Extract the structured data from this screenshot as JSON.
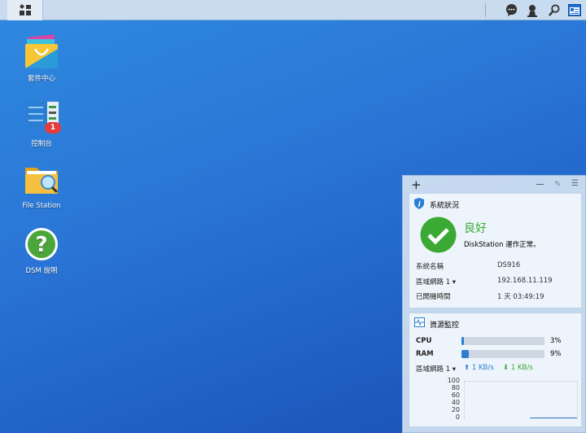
{
  "taskbar": {
    "icons": [
      "main-menu-icon",
      "notification-chat-icon",
      "user-icon",
      "search-icon",
      "widgets-icon"
    ]
  },
  "desktop": {
    "items": [
      {
        "label": "套件中心",
        "icon": "package-center-icon"
      },
      {
        "label": "控制台",
        "icon": "control-panel-icon",
        "badge": "1"
      },
      {
        "label": "File Station",
        "icon": "file-station-icon"
      },
      {
        "label": "DSM 說明",
        "icon": "dsm-help-icon"
      }
    ]
  },
  "widget": {
    "add": "+",
    "system_health": {
      "title": "系統狀況",
      "status": "良好",
      "message": "DiskStation 運作正常。",
      "rows": [
        {
          "label": "系統名稱",
          "value": "DS916"
        },
        {
          "label": "區域網路 1 ▾",
          "value": "192.168.11.119"
        },
        {
          "label": "已開機時間",
          "value": "1 天 03:49:19"
        }
      ],
      "status_color": "#3aaa35"
    },
    "resource_monitor": {
      "title": "資源監控",
      "cpu": {
        "label": "CPU",
        "percent": 3,
        "text": "3%"
      },
      "ram": {
        "label": "RAM",
        "percent": 9,
        "text": "9%"
      },
      "network": {
        "label": "區域網路 1 ▾",
        "upload": "1 KB/s",
        "download": "1 KB/s"
      },
      "axis": [
        "100",
        "80",
        "60",
        "40",
        "20",
        "0"
      ]
    }
  }
}
